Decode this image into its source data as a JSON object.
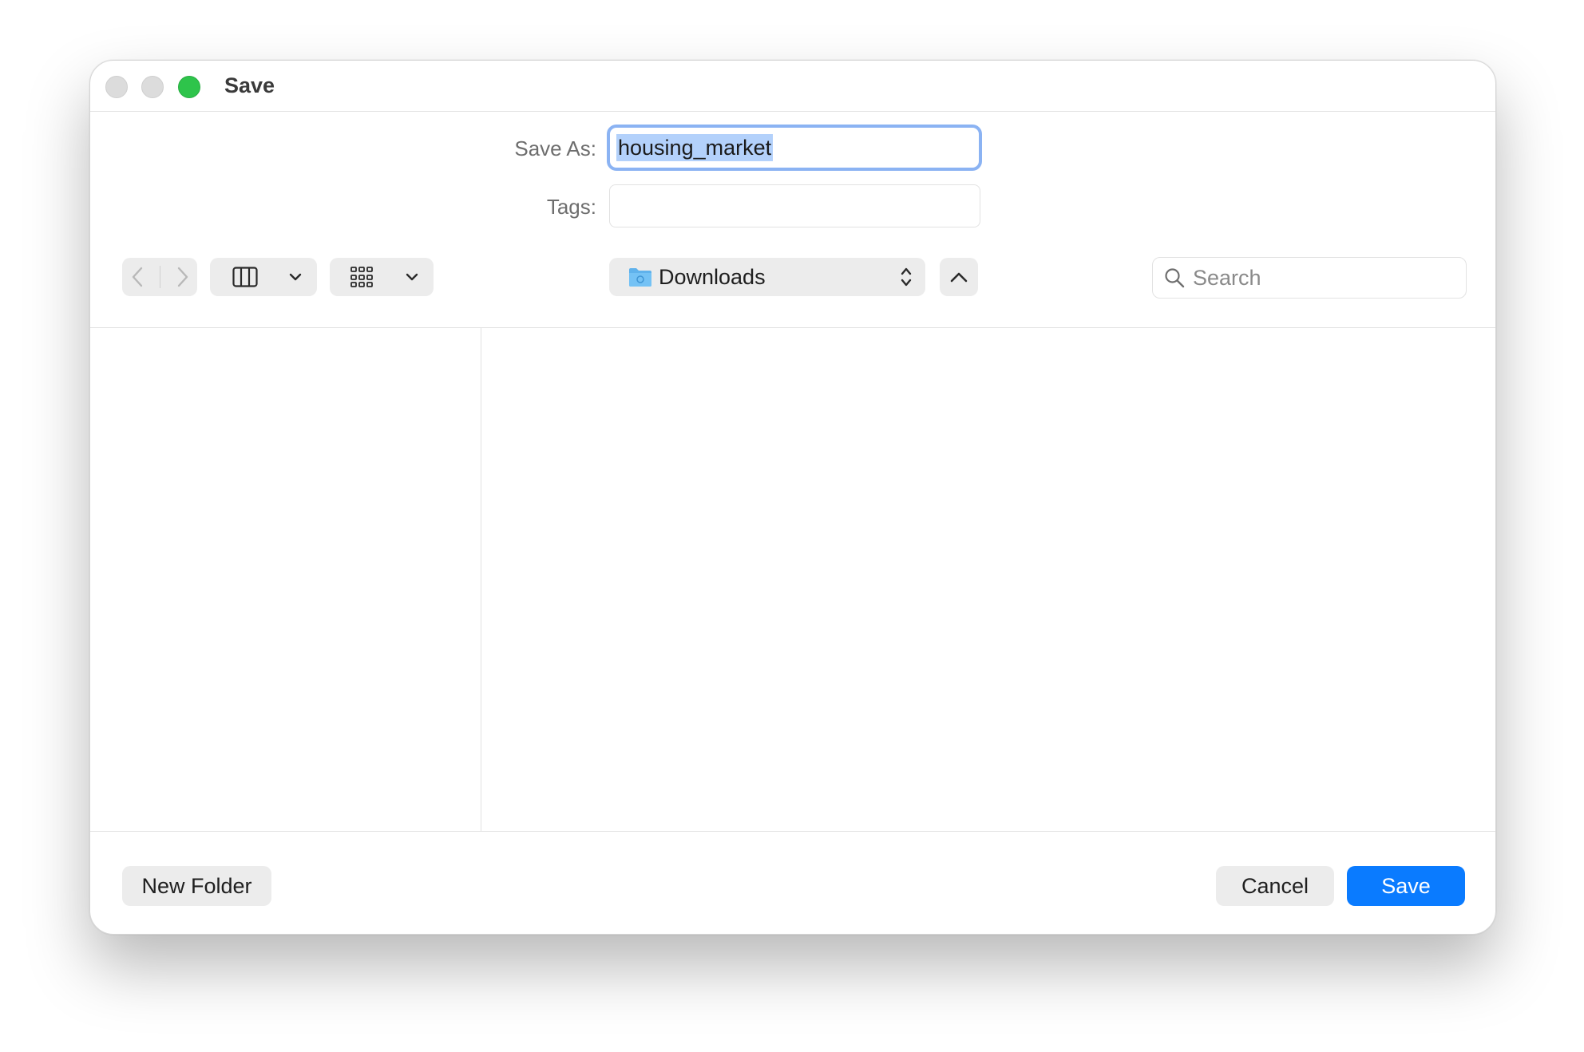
{
  "window": {
    "title": "Save"
  },
  "form": {
    "save_as_label": "Save As:",
    "save_as_value": "housing_market",
    "tags_label": "Tags:",
    "tags_value": ""
  },
  "toolbar": {
    "location": "Downloads",
    "search_placeholder": "Search"
  },
  "buttons": {
    "new_folder": "New Folder",
    "cancel": "Cancel",
    "save": "Save"
  },
  "icons": {
    "back": "chevron-left-icon",
    "forward": "chevron-right-icon",
    "column_view": "column-view-icon",
    "grid_view": "grid-view-icon",
    "folder": "folder-icon",
    "updown": "up-down-chevron-icon",
    "up": "chevron-up-icon",
    "search": "search-icon"
  },
  "colors": {
    "accent": "#0a7bff",
    "focus_ring": "#8bb3f3",
    "selection": "#b3d1fb",
    "zoom_button": "#2ec44b"
  }
}
